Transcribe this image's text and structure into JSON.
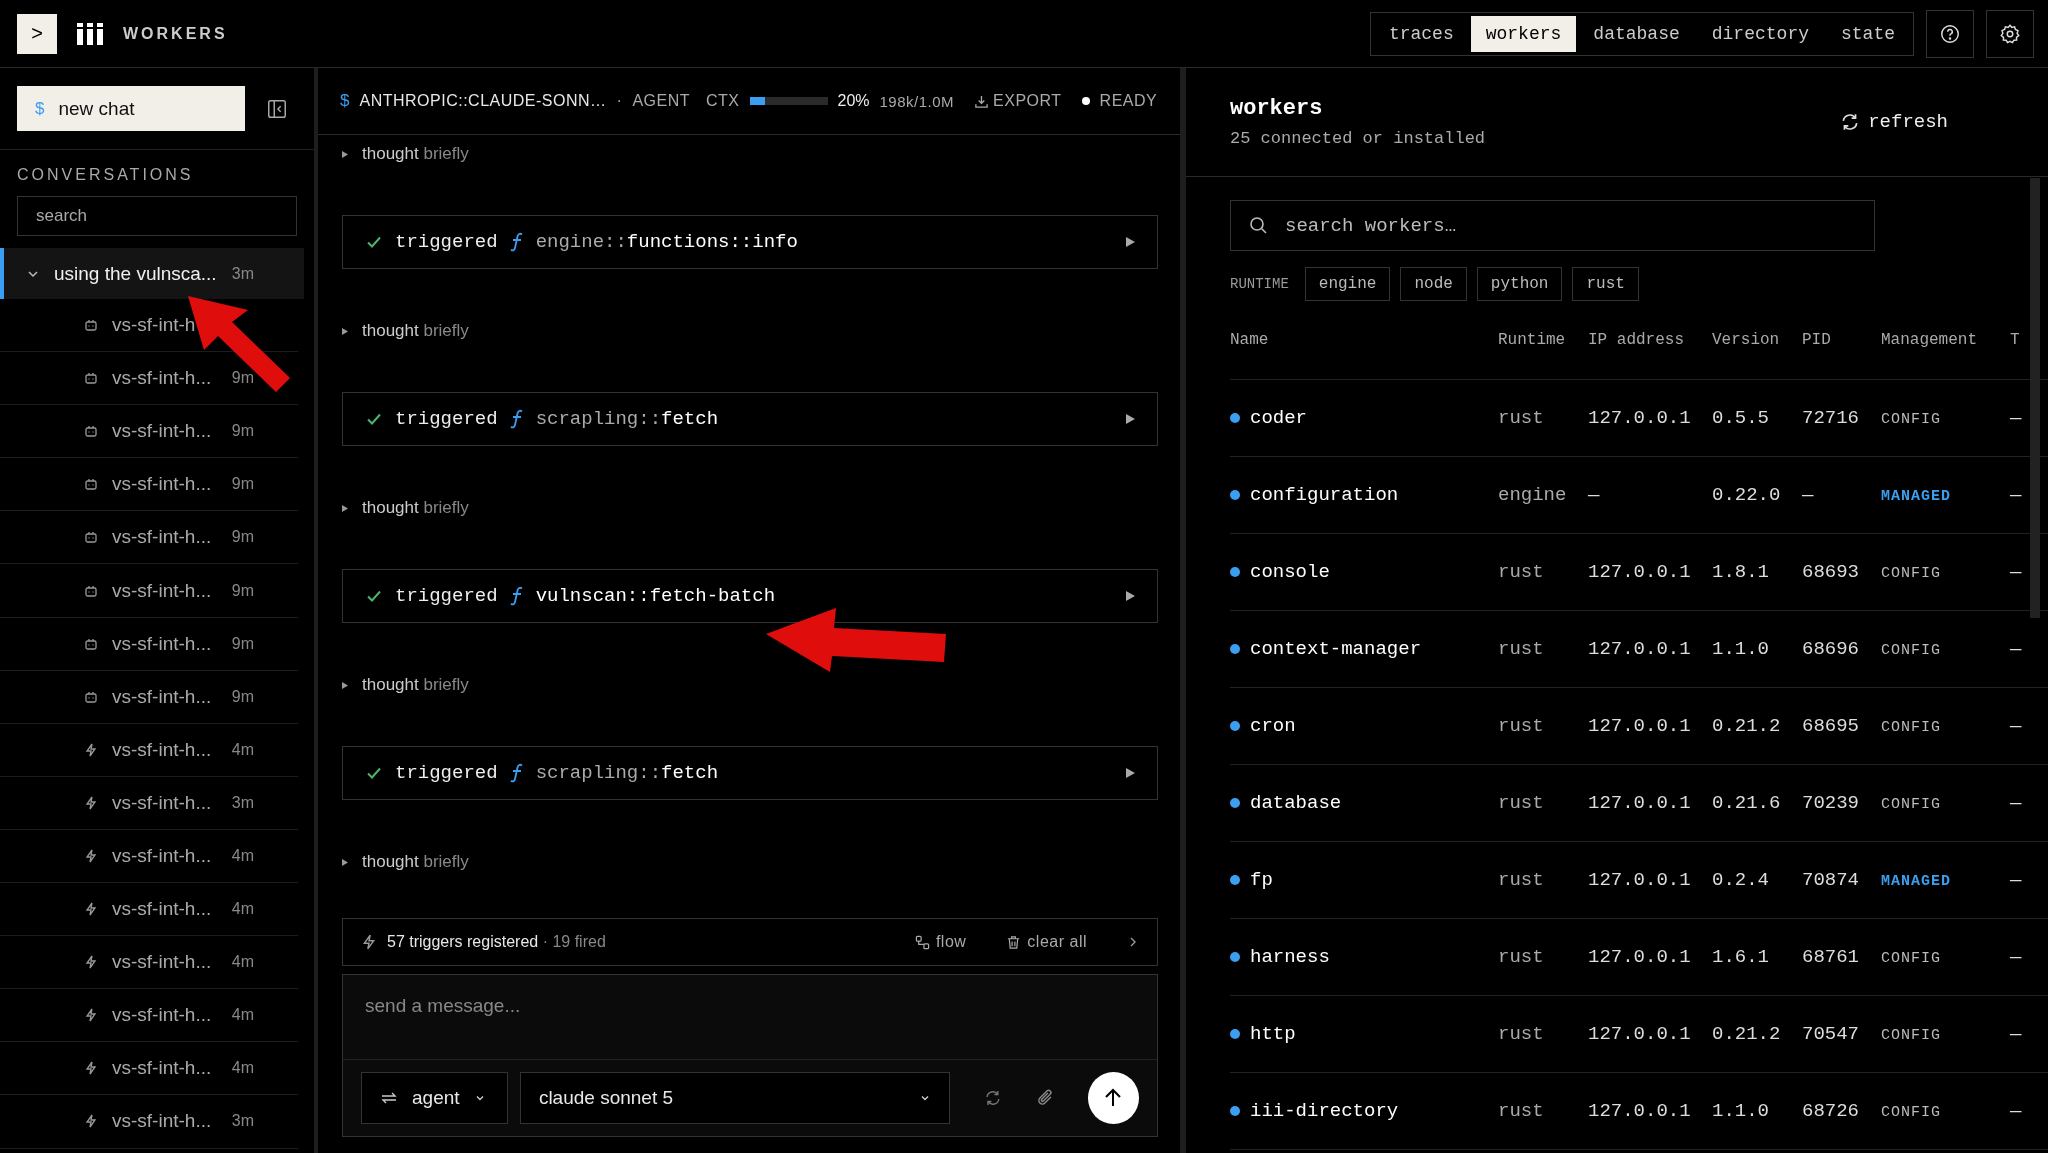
{
  "topbar": {
    "prompt_key": ">",
    "title": "WORKERS",
    "tabs": [
      {
        "label": "traces",
        "selected": false
      },
      {
        "label": "workers",
        "selected": true
      },
      {
        "label": "database",
        "selected": false
      },
      {
        "label": "directory",
        "selected": false
      },
      {
        "label": "state",
        "selected": false
      }
    ]
  },
  "sidebar": {
    "new_chat": {
      "symbol": "$",
      "label": "new chat"
    },
    "heading": "CONVERSATIONS",
    "search": {
      "placeholder": "search"
    },
    "conversations": [
      {
        "title": "using the vulnsca...",
        "time": "3m",
        "selected": true,
        "expanded": true,
        "children": [
          {
            "kind": "bot",
            "title": "vs-sf-int-h"
          },
          {
            "kind": "bot",
            "title": "vs-sf-int-h...",
            "time": "9m"
          },
          {
            "kind": "bot",
            "title": "vs-sf-int-h...",
            "time": "9m"
          },
          {
            "kind": "bot",
            "title": "vs-sf-int-h...",
            "time": "9m"
          },
          {
            "kind": "bot",
            "title": "vs-sf-int-h...",
            "time": "9m"
          },
          {
            "kind": "bot",
            "title": "vs-sf-int-h...",
            "time": "9m"
          },
          {
            "kind": "bot",
            "title": "vs-sf-int-h...",
            "time": "9m"
          },
          {
            "kind": "bot",
            "title": "vs-sf-int-h...",
            "time": "9m"
          },
          {
            "kind": "trigger",
            "title": "vs-sf-int-h...",
            "time": "4m"
          },
          {
            "kind": "trigger",
            "title": "vs-sf-int-h...",
            "time": "3m"
          },
          {
            "kind": "trigger",
            "title": "vs-sf-int-h...",
            "time": "4m"
          },
          {
            "kind": "trigger",
            "title": "vs-sf-int-h...",
            "time": "4m"
          },
          {
            "kind": "trigger",
            "title": "vs-sf-int-h...",
            "time": "4m"
          },
          {
            "kind": "trigger",
            "title": "vs-sf-int-h...",
            "time": "4m"
          },
          {
            "kind": "trigger",
            "title": "vs-sf-int-h...",
            "time": "4m"
          },
          {
            "kind": "trigger",
            "title": "vs-sf-int-h...",
            "time": "3m"
          }
        ]
      }
    ]
  },
  "chat": {
    "header": {
      "symbol": "$",
      "model": "ANTHROPIC::CLAUDE-SONN…",
      "separator": "·",
      "mode": "AGENT",
      "ctx_label": "CTX",
      "ctx": {
        "level": 0.2
      },
      "ctx_percent": "20%",
      "ctx_tokens": "198k/1.0M",
      "export": "EXPORT",
      "status": "READY"
    },
    "messages": [
      {
        "kind": "thought",
        "verb": "thought",
        "detail": "briefly"
      },
      {
        "kind": "trigger",
        "verb": "triggered",
        "namespace": "engine::",
        "function": "functions::info"
      },
      {
        "kind": "thought",
        "verb": "thought",
        "detail": "briefly"
      },
      {
        "kind": "trigger",
        "verb": "triggered",
        "namespace": "scrapling::",
        "function": "fetch"
      },
      {
        "kind": "thought",
        "verb": "thought",
        "detail": "briefly"
      },
      {
        "kind": "trigger",
        "verb": "triggered",
        "function": "vulnscan::fetch-batch"
      },
      {
        "kind": "thought",
        "verb": "thought",
        "detail": "briefly"
      },
      {
        "kind": "trigger",
        "verb": "triggered",
        "namespace": "scrapling::",
        "function": "fetch"
      },
      {
        "kind": "thought",
        "verb": "thought",
        "detail": "briefly"
      }
    ],
    "triggers_bar": {
      "registered": "57 triggers registered",
      "fired": "· 19 fired",
      "flow": "flow",
      "clear": "clear all"
    },
    "composer": {
      "placeholder": "send a message...",
      "mode": "agent",
      "model": "claude sonnet 5"
    }
  },
  "workers": {
    "title": "workers",
    "subtitle": "25 connected or installed",
    "refresh": "refresh",
    "search": {
      "placeholder": "search workers…"
    },
    "runtime_label": "RUNTIME",
    "runtime_filters": [
      "engine",
      "node",
      "python",
      "rust"
    ],
    "columns": [
      "Name",
      "Runtime",
      "IP address",
      "Version",
      "PID",
      "Management",
      "T"
    ],
    "rows": [
      {
        "name": "coder",
        "runtime": "rust",
        "ip": "127.0.0.1",
        "version": "0.5.5",
        "pid": "72716",
        "management": "CONFIG",
        "kind": "config",
        "column_7": "—"
      },
      {
        "name": "configuration",
        "runtime": "engine",
        "ip": "—",
        "version": "0.22.0",
        "pid": "—",
        "management": "MANAGED",
        "kind": "managed",
        "column_7": "—"
      },
      {
        "name": "console",
        "runtime": "rust",
        "ip": "127.0.0.1",
        "version": "1.8.1",
        "pid": "68693",
        "management": "CONFIG",
        "kind": "config",
        "column_7": "—"
      },
      {
        "name": "context-manager",
        "runtime": "rust",
        "ip": "127.0.0.1",
        "version": "1.1.0",
        "pid": "68696",
        "management": "CONFIG",
        "kind": "config",
        "column_7": "—"
      },
      {
        "name": "cron",
        "runtime": "rust",
        "ip": "127.0.0.1",
        "version": "0.21.2",
        "pid": "68695",
        "management": "CONFIG",
        "kind": "config",
        "column_7": "—"
      },
      {
        "name": "database",
        "runtime": "rust",
        "ip": "127.0.0.1",
        "version": "0.21.6",
        "pid": "70239",
        "management": "CONFIG",
        "kind": "config",
        "column_7": "—"
      },
      {
        "name": "fp",
        "runtime": "rust",
        "ip": "127.0.0.1",
        "version": "0.2.4",
        "pid": "70874",
        "management": "MANAGED",
        "kind": "managed",
        "column_7": "—"
      },
      {
        "name": "harness",
        "runtime": "rust",
        "ip": "127.0.0.1",
        "version": "1.6.1",
        "pid": "68761",
        "management": "CONFIG",
        "kind": "config",
        "column_7": "—"
      },
      {
        "name": "http",
        "runtime": "rust",
        "ip": "127.0.0.1",
        "version": "0.21.2",
        "pid": "70547",
        "management": "CONFIG",
        "kind": "config",
        "column_7": "—"
      },
      {
        "name": "iii-directory",
        "runtime": "rust",
        "ip": "127.0.0.1",
        "version": "1.1.0",
        "pid": "68726",
        "management": "CONFIG",
        "kind": "config",
        "column_7": "—"
      }
    ]
  }
}
